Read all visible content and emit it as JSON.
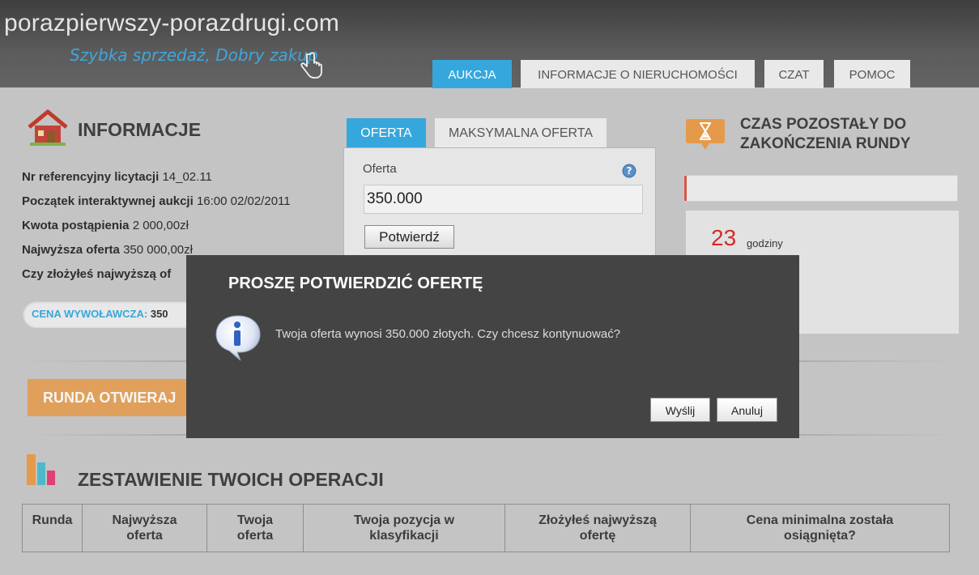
{
  "header": {
    "site_name": "porazpierwszy-porazdrugi.com",
    "tagline": "Szybka sprzedaż, Dobry zakup",
    "tabs": [
      {
        "label": "AUKCJA",
        "active": true
      },
      {
        "label": "INFORMACJE O NIERUCHOMOŚCI",
        "active": false
      },
      {
        "label": "CZAT",
        "active": false
      },
      {
        "label": "POMOC",
        "active": false
      }
    ]
  },
  "info": {
    "title": "INFORMACJE",
    "rows": [
      {
        "label": "Nr referencyjny licytacji",
        "value": "14_02.11"
      },
      {
        "label": "Początek interaktywnej aukcji",
        "value": "16:00 02/02/2011"
      },
      {
        "label": "Kwota postąpienia",
        "value": "2 000,00zł"
      },
      {
        "label": "Najwyższa oferta",
        "value": "350 000,00zł"
      },
      {
        "label": "Czy złożyłeś najwyższą of",
        "value": ""
      }
    ],
    "starting_price_label": "CENA WYWOŁAWCZA:",
    "starting_price_value": "350"
  },
  "offer": {
    "tabs": [
      {
        "label": "OFERTA",
        "active": true
      },
      {
        "label": "MAKSYMALNA OFERTA",
        "active": false
      }
    ],
    "field_label": "Oferta",
    "field_value": "350.000",
    "confirm_label": "Potwierdź"
  },
  "timer": {
    "title_line1": "CZAS POZOSTAŁY DO",
    "title_line2": "ZAKOŃCZENIA RUNDY",
    "progress": 0.01,
    "hours_value": "23",
    "hours_label": "godziny"
  },
  "round_banner": "RUNDA OTWIERAJ",
  "operations": {
    "title": "ZESTAWIENIE TWOICH OPERACJI",
    "columns": [
      [
        "Runda"
      ],
      [
        "Najwyższa",
        "oferta"
      ],
      [
        "Twoja",
        "oferta"
      ],
      [
        "Twoja pozycja w",
        "klasyfikacji"
      ],
      [
        "Złożyłeś najwyższą",
        "ofertę"
      ],
      [
        "Cena minimalna została",
        "osiągnięta?"
      ]
    ]
  },
  "dialog": {
    "title": "PROSZĘ POTWIERDZIĆ OFERTĘ",
    "message": "Twoja oferta wynosi 350.000 złotych. Czy chcesz kontynuować?",
    "send_label": "Wyślij",
    "cancel_label": "Anuluj"
  },
  "colors": {
    "accent": "#36a7dc",
    "orange": "#e59a4b",
    "red": "#d6282c",
    "dialog_bg": "#444444"
  }
}
